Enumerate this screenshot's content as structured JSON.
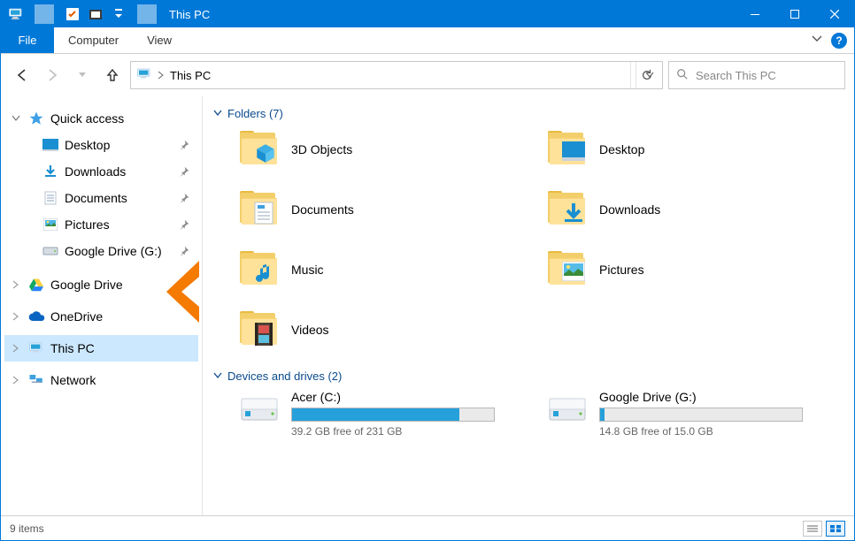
{
  "window": {
    "title": "This PC"
  },
  "ribbon": {
    "file": "File",
    "tabs": [
      "Computer",
      "View"
    ]
  },
  "address": {
    "crumb": "This PC",
    "search_placeholder": "Search This PC"
  },
  "tree": {
    "quick_access": {
      "label": "Quick access",
      "items": [
        {
          "label": "Desktop",
          "pinned": true
        },
        {
          "label": "Downloads",
          "pinned": true
        },
        {
          "label": "Documents",
          "pinned": true
        },
        {
          "label": "Pictures",
          "pinned": true
        },
        {
          "label": "Google Drive (G:)",
          "pinned": true
        }
      ]
    },
    "roots": [
      {
        "label": "Google Drive"
      },
      {
        "label": "OneDrive"
      },
      {
        "label": "This PC",
        "selected": true
      },
      {
        "label": "Network"
      }
    ]
  },
  "groups": {
    "folders": {
      "header": "Folders (7)",
      "items": [
        {
          "name": "3D Objects"
        },
        {
          "name": "Desktop"
        },
        {
          "name": "Documents"
        },
        {
          "name": "Downloads"
        },
        {
          "name": "Music"
        },
        {
          "name": "Pictures"
        },
        {
          "name": "Videos"
        }
      ]
    },
    "drives": {
      "header": "Devices and drives (2)",
      "items": [
        {
          "name": "Acer (C:)",
          "free_text": "39.2 GB free of 231 GB",
          "fill_pct": 83
        },
        {
          "name": "Google Drive (G:)",
          "free_text": "14.8 GB free of 15.0 GB",
          "fill_pct": 2
        }
      ]
    }
  },
  "status": {
    "text": "9 items"
  }
}
